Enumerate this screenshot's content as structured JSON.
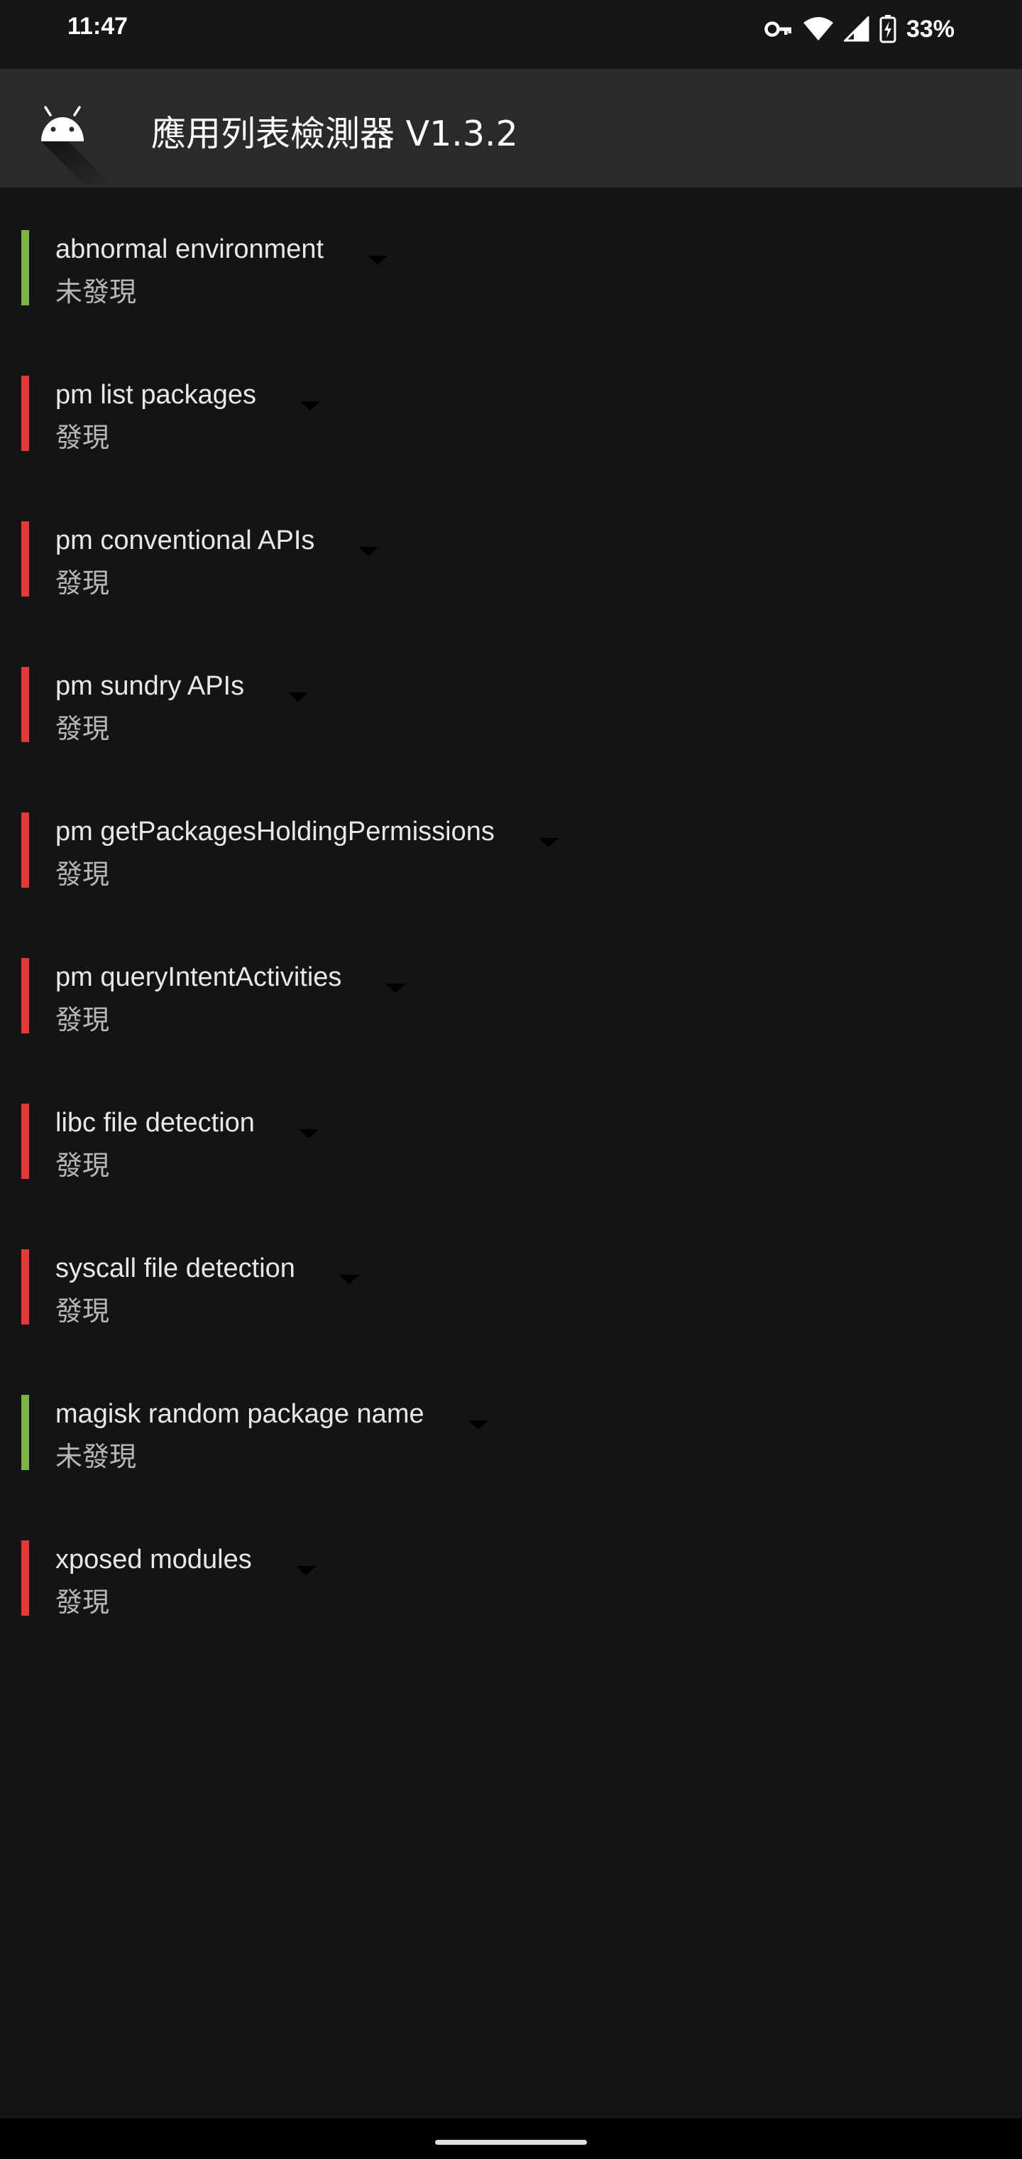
{
  "status_bar": {
    "time": "11:47",
    "battery_percent": "33%",
    "icons": [
      "vpn-key-icon",
      "wifi-icon",
      "cellular-signal-icon",
      "battery-charging-icon"
    ]
  },
  "app_bar": {
    "icon": "android-icon",
    "title": "應用列表檢測器 V1.3.2"
  },
  "colors": {
    "pass": "#7cb342",
    "fail": "#e53935",
    "background": "#141416",
    "app_bar": "#2a2a2d"
  },
  "checks": [
    {
      "title": "abnormal environment",
      "status": "未發現",
      "result": "pass"
    },
    {
      "title": "pm list packages",
      "status": "發現",
      "result": "fail"
    },
    {
      "title": "pm conventional APIs",
      "status": "發現",
      "result": "fail"
    },
    {
      "title": "pm sundry APIs",
      "status": "發現",
      "result": "fail"
    },
    {
      "title": "pm getPackagesHoldingPermissions",
      "status": "發現",
      "result": "fail"
    },
    {
      "title": "pm queryIntentActivities",
      "status": "發現",
      "result": "fail"
    },
    {
      "title": "libc file detection",
      "status": "發現",
      "result": "fail"
    },
    {
      "title": "syscall file detection",
      "status": "發現",
      "result": "fail"
    },
    {
      "title": "magisk random package name",
      "status": "未發現",
      "result": "pass"
    },
    {
      "title": "xposed modules",
      "status": "發現",
      "result": "fail"
    }
  ]
}
